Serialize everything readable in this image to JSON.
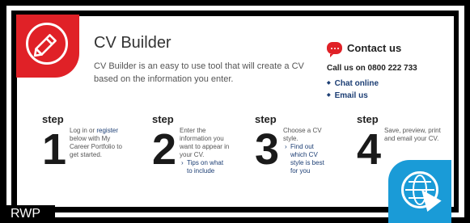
{
  "header": {
    "title": "CV Builder",
    "intro": "CV Builder is an easy to use tool that will create a CV based on the information you enter."
  },
  "contact": {
    "title": "Contact us",
    "phone": "Call us on 0800 222 733",
    "links": [
      "Chat online",
      "Email us"
    ]
  },
  "steps": [
    {
      "word": "step",
      "number": "1",
      "text_before": "Log in or ",
      "link": "register",
      "text_after": " below with My Career Portfolio to get started.",
      "sub": ""
    },
    {
      "word": "step",
      "number": "2",
      "text": "Enter the information you want to appear in your CV.",
      "sub": "Tips on what to include"
    },
    {
      "word": "step",
      "number": "3",
      "text": "Choose a CV style.",
      "sub": "Find out which CV style is best for you"
    },
    {
      "word": "step",
      "number": "4",
      "text": "Save, preview, print and email your CV.",
      "sub": ""
    }
  ],
  "watermark": "RWP",
  "icons": {
    "edit": "pencil-icon",
    "chat": "chat-bubble-icon",
    "web": "globe-cursor-icon"
  },
  "colors": {
    "accent_red": "#e02127",
    "link_blue": "#1c3e74",
    "badge_blue": "#1a9bd7"
  }
}
